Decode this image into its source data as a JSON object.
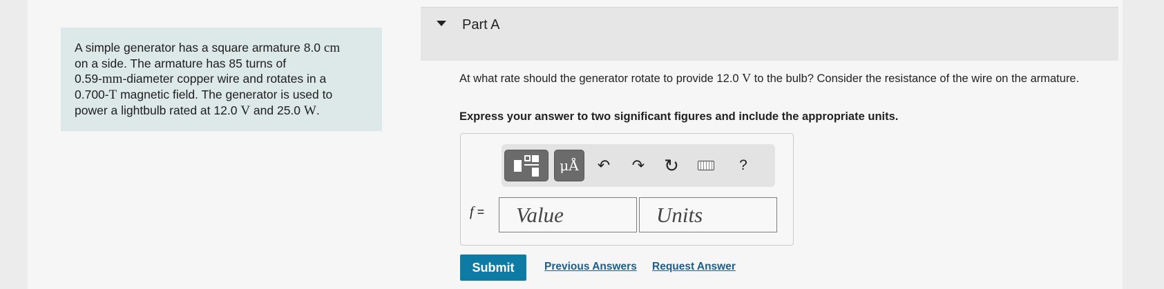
{
  "problem": {
    "line1_a": "A simple generator has a square armature 8.0 ",
    "line1_unit": "cm",
    "line2": "on a side. The armature has 85 turns of",
    "line3_a": "0.59-",
    "line3_unit": "mm",
    "line3_b": "-diameter copper wire and rotates in a",
    "line4_a": "0.700-",
    "line4_unit": "T",
    "line4_b": " magnetic field. The generator is used to",
    "line5_a": "power a lightbulb rated at 12.0 ",
    "line5_unit1": "V",
    "line5_b": " and 25.0 ",
    "line5_unit2": "W",
    "line5_c": "."
  },
  "part": {
    "title": "Part A"
  },
  "question": {
    "text_a": "At what rate should the generator rotate to provide 12.0 ",
    "text_unit": "V",
    "text_b": " to the bulb? Consider the resistance of the wire on the armature.",
    "instruction": "Express your answer to two significant figures and include the appropriate units."
  },
  "toolbar": {
    "units_label": "μÅ",
    "undo_glyph": "↶",
    "redo_glyph": "↷",
    "reset_glyph": "↻",
    "help_label": "?"
  },
  "answer": {
    "var": "f",
    "equals": " =",
    "value_placeholder": "Value",
    "units_placeholder": "Units"
  },
  "actions": {
    "submit_label": "Submit",
    "previous_answers": "Previous Answers",
    "request_answer": "Request Answer"
  },
  "colors": {
    "submit_bg": "#0d7ba4",
    "link": "#1a5d8f",
    "problem_bg": "#dde8e8"
  }
}
